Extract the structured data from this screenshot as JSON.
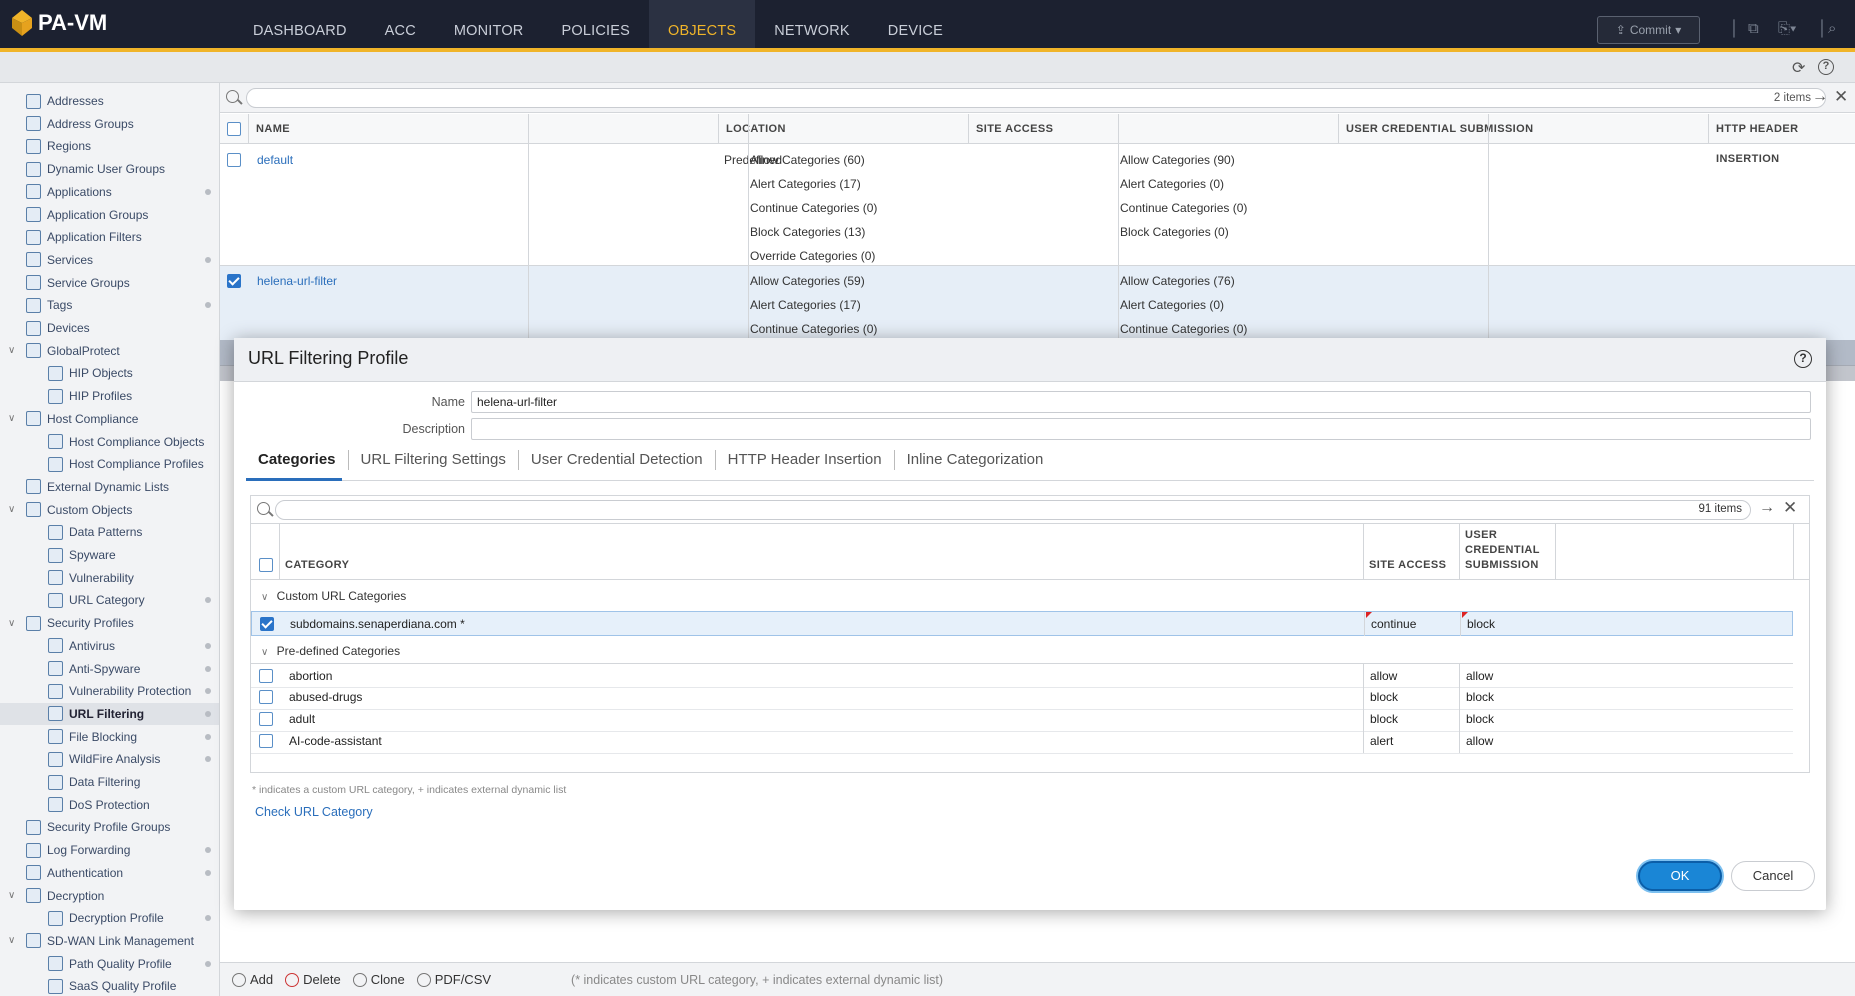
{
  "app": {
    "logo_text": "PA-VM"
  },
  "nav": {
    "tabs": [
      {
        "label": "DASHBOARD"
      },
      {
        "label": "ACC"
      },
      {
        "label": "MONITOR"
      },
      {
        "label": "POLICIES"
      },
      {
        "label": "OBJECTS"
      },
      {
        "label": "NETWORK"
      },
      {
        "label": "DEVICE"
      }
    ],
    "active": "OBJECTS",
    "commit_label": "Commit"
  },
  "sidebar": {
    "items": [
      {
        "label": "Addresses"
      },
      {
        "label": "Address Groups"
      },
      {
        "label": "Regions"
      },
      {
        "label": "Dynamic User Groups"
      },
      {
        "label": "Applications"
      },
      {
        "label": "Application Groups"
      },
      {
        "label": "Application Filters"
      },
      {
        "label": "Services"
      },
      {
        "label": "Service Groups"
      },
      {
        "label": "Tags"
      },
      {
        "label": "Devices"
      },
      {
        "label": "GlobalProtect"
      },
      {
        "label": "HIP Objects"
      },
      {
        "label": "HIP Profiles"
      },
      {
        "label": "Host Compliance"
      },
      {
        "label": "Host Compliance Objects"
      },
      {
        "label": "Host Compliance Profiles"
      },
      {
        "label": "External Dynamic Lists"
      },
      {
        "label": "Custom Objects"
      },
      {
        "label": "Data Patterns"
      },
      {
        "label": "Spyware"
      },
      {
        "label": "Vulnerability"
      },
      {
        "label": "URL Category"
      },
      {
        "label": "Security Profiles"
      },
      {
        "label": "Antivirus"
      },
      {
        "label": "Anti-Spyware"
      },
      {
        "label": "Vulnerability Protection"
      },
      {
        "label": "URL Filtering"
      },
      {
        "label": "File Blocking"
      },
      {
        "label": "WildFire Analysis"
      },
      {
        "label": "Data Filtering"
      },
      {
        "label": "DoS Protection"
      },
      {
        "label": "Security Profile Groups"
      },
      {
        "label": "Log Forwarding"
      },
      {
        "label": "Authentication"
      },
      {
        "label": "Decryption"
      },
      {
        "label": "Decryption Profile"
      },
      {
        "label": "SD-WAN Link Management"
      },
      {
        "label": "Path Quality Profile"
      },
      {
        "label": "SaaS Quality Profile"
      }
    ],
    "active": "URL Filtering"
  },
  "main": {
    "items_count": "2 items",
    "columns": [
      "NAME",
      "LOCATION",
      "SITE ACCESS",
      "USER CREDENTIAL SUBMISSION",
      "HTTP HEADER INSERTION"
    ],
    "rows": [
      {
        "name": "default",
        "location": "Predefined",
        "site_access": [
          "Allow Categories (60)",
          "Alert Categories (17)",
          "Continue Categories (0)",
          "Block Categories (13)",
          "Override Categories (0)"
        ],
        "user_credential": [
          "Allow Categories (90)",
          "Alert Categories (0)",
          "Continue Categories (0)",
          "Block Categories (0)"
        ]
      },
      {
        "name": "helena-url-filter",
        "location": "",
        "site_access": [
          "Allow Categories (59)",
          "Alert Categories (17)",
          "Continue Categories (0)"
        ],
        "user_credential": [
          "Allow Categories (76)",
          "Alert Categories (0)",
          "Continue Categories (0)"
        ]
      }
    ]
  },
  "bottombar": {
    "add": "Add",
    "delete": "Delete",
    "clone": "Clone",
    "pdf": "PDF/CSV",
    "note": "(* indicates custom URL category, + indicates external dynamic list)"
  },
  "modal": {
    "title": "URL Filtering Profile",
    "name_label": "Name",
    "name_value": "helena-url-filter",
    "description_label": "Description",
    "description_value": "",
    "tabs": [
      "Categories",
      "URL Filtering Settings",
      "User Credential Detection",
      "HTTP Header Insertion",
      "Inline Categorization"
    ],
    "grid": {
      "items_count": "91 items",
      "col_category": "CATEGORY",
      "col_site_access": "SITE ACCESS",
      "col_user_cred": "USER CREDENTIAL SUBMISSION",
      "group_custom": "Custom URL Categories",
      "custom_rows": [
        {
          "category": "subdomains.senaperdiana.com *",
          "site_access": "continue",
          "user_cred": "block"
        }
      ],
      "group_predefined": "Pre-defined Categories",
      "predefined_rows": [
        {
          "category": "abortion",
          "site_access": "allow",
          "user_cred": "allow"
        },
        {
          "category": "abused-drugs",
          "site_access": "block",
          "user_cred": "block"
        },
        {
          "category": "adult",
          "site_access": "block",
          "user_cred": "block"
        },
        {
          "category": "AI-code-assistant",
          "site_access": "alert",
          "user_cred": "allow"
        }
      ]
    },
    "note": "* indicates a custom URL category, + indicates external dynamic list",
    "check_link": "Check URL Category",
    "ok": "OK",
    "cancel": "Cancel"
  }
}
